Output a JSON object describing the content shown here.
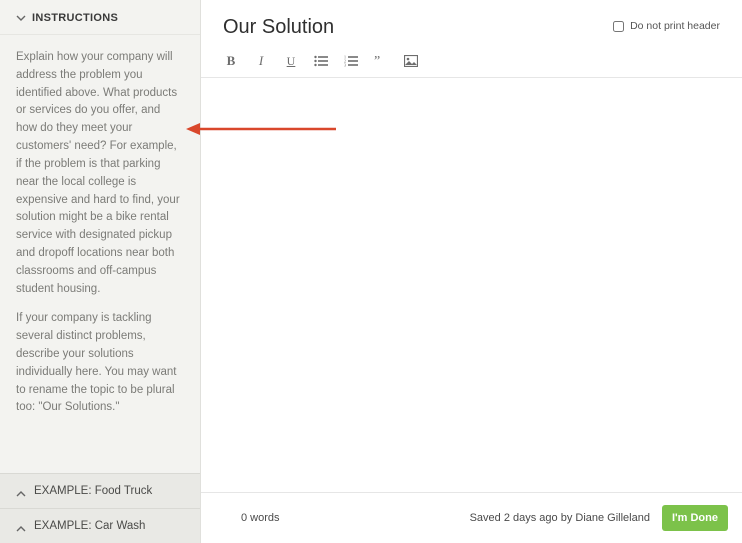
{
  "sidebar": {
    "header_title": "INSTRUCTIONS",
    "para1": "Explain how your company will address the problem you identified above. What products or services do you offer, and how do they meet your customers' need? For example, if the problem is that parking near the local college is expensive and hard to find, your solution might be a bike rental service with designated pickup and dropoff locations near both classrooms and off-campus student housing.",
    "para2": "If your company is tackling several distinct problems, describe your solutions individually here. You may want to rename the topic to be plural too: \"Our Solutions.\"",
    "examples": [
      {
        "label": "EXAMPLE: Food Truck"
      },
      {
        "label": "EXAMPLE: Car Wash"
      }
    ]
  },
  "main": {
    "title": "Our Solution",
    "print_header_label": "Do not print header"
  },
  "status": {
    "word_count": "0 words",
    "saved": "Saved 2 days ago by Diane Gilleland",
    "done_label": "I'm Done"
  }
}
